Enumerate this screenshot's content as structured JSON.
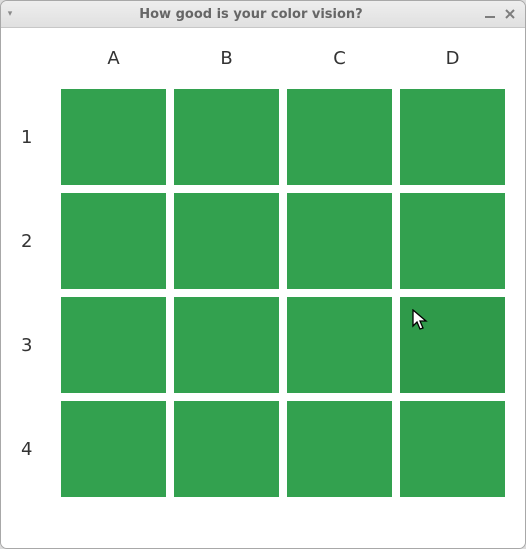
{
  "window": {
    "title": "How good is your color vision?"
  },
  "board": {
    "columns": [
      "A",
      "B",
      "C",
      "D"
    ],
    "rows": [
      "1",
      "2",
      "3",
      "4"
    ],
    "base_color": "#33a14f",
    "odd_color": "#2f9a4a",
    "odd_cell": {
      "row": 3,
      "col": "D"
    },
    "cursor_at": {
      "row": 3,
      "col": "D"
    }
  }
}
